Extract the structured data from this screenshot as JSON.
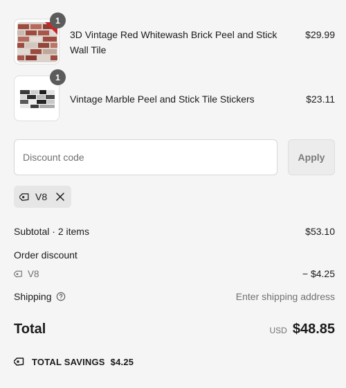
{
  "cart": {
    "items": [
      {
        "title": "3D Vintage Red Whitewash Brick Peel and Stick Wall Tile",
        "price": "$29.99",
        "quantity": "1"
      },
      {
        "title": "Vintage Marble Peel and Stick Tile Stickers",
        "price": "$23.11",
        "quantity": "1"
      }
    ]
  },
  "discount": {
    "placeholder": "Discount code",
    "apply_label": "Apply",
    "applied_code": "V8"
  },
  "summary": {
    "subtotal_label": "Subtotal · 2 items",
    "subtotal_value": "$53.10",
    "order_discount_label": "Order discount",
    "discount_code": "V8",
    "discount_value": "− $4.25",
    "shipping_label": "Shipping",
    "shipping_value": "Enter shipping address",
    "total_label": "Total",
    "currency": "USD",
    "total_value": "$48.85",
    "savings_label": "TOTAL SAVINGS",
    "savings_value": "$4.25"
  },
  "icons": {
    "tag": "tag-icon",
    "close": "close-icon",
    "help": "help-circle-icon",
    "savings_tag": "savings-tag-icon"
  },
  "colors": {
    "background": "#f5f5f5",
    "badge": "#5c5c5c",
    "muted_text": "#707070"
  }
}
